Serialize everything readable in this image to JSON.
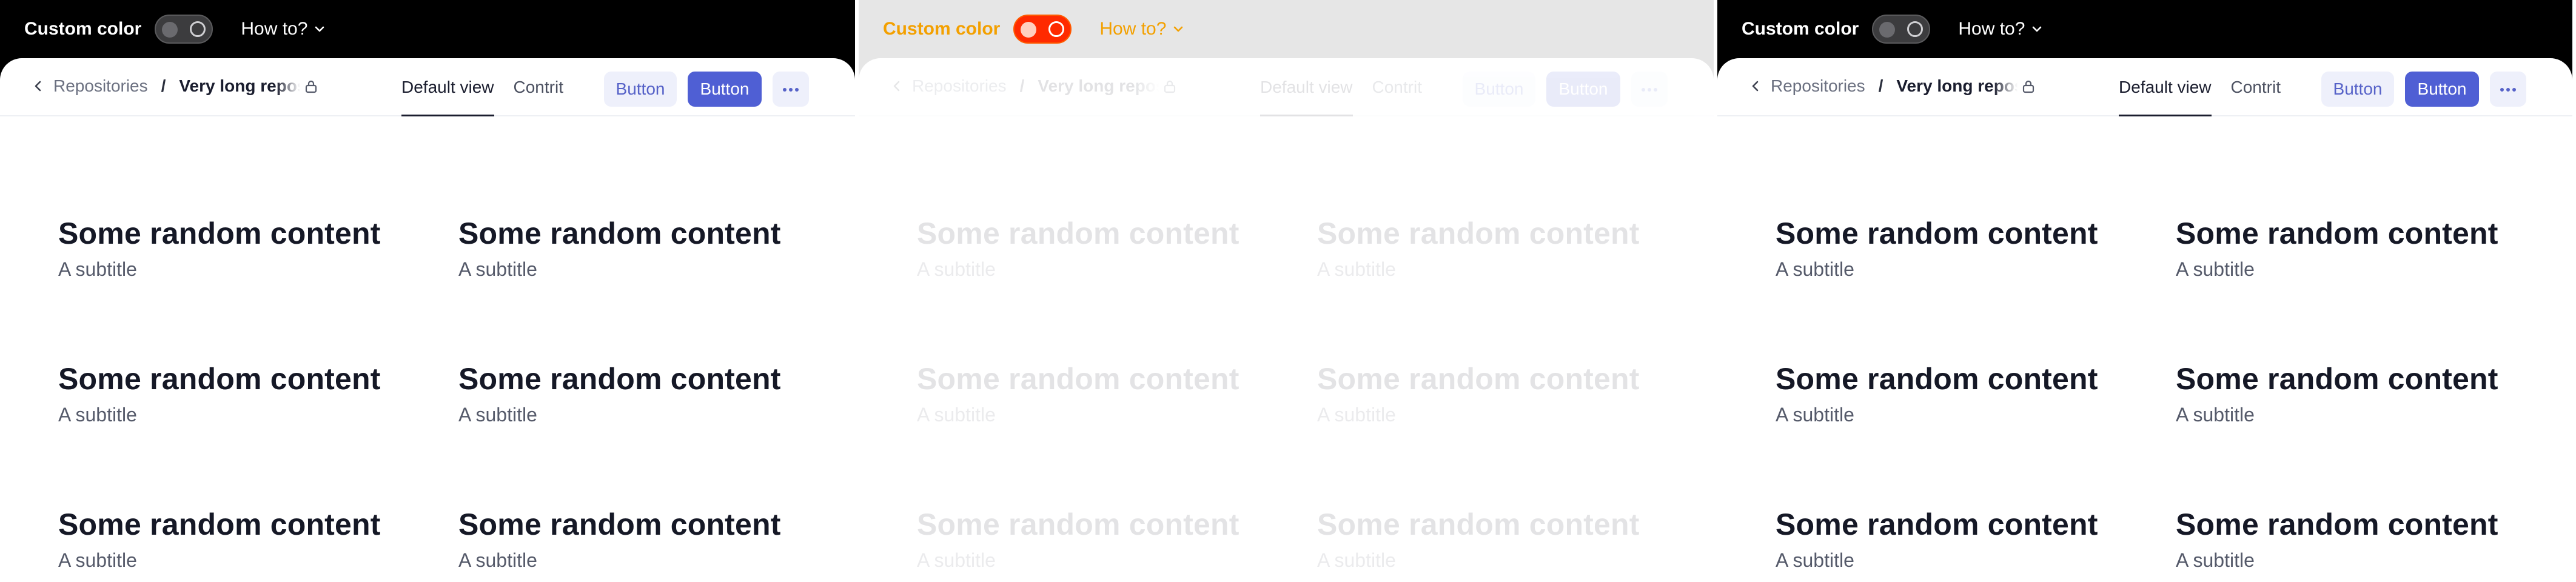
{
  "topbar": {
    "custom_color_label": "Custom color",
    "how_to_label": "How to?"
  },
  "breadcrumb": {
    "parent": "Repositories",
    "separator": "/",
    "current": "Very long repos"
  },
  "tabs": [
    "Default view",
    "Contrit"
  ],
  "actions": {
    "secondary_label": "Button",
    "primary_label": "Button"
  },
  "content": {
    "items": [
      {
        "title": "Some random content",
        "subtitle": "A subtitle"
      },
      {
        "title": "Some random content",
        "subtitle": "A subtitle"
      },
      {
        "title": "Some random content",
        "subtitle": "A subtitle"
      },
      {
        "title": "Some random content",
        "subtitle": "A subtitle"
      },
      {
        "title": "Some random content",
        "subtitle": "A subtitle"
      },
      {
        "title": "Some random content",
        "subtitle": "A subtitle"
      }
    ]
  },
  "colors": {
    "primary": "#4f5fd4",
    "primary_soft": "#eef0fb",
    "topbar_bg": "#000000",
    "text_dark": "#151826"
  },
  "icons": {
    "back": "chevron-left-icon",
    "lock": "lock-icon",
    "more": "more-horizontal-icon",
    "howto": "chevron-down-icon"
  }
}
